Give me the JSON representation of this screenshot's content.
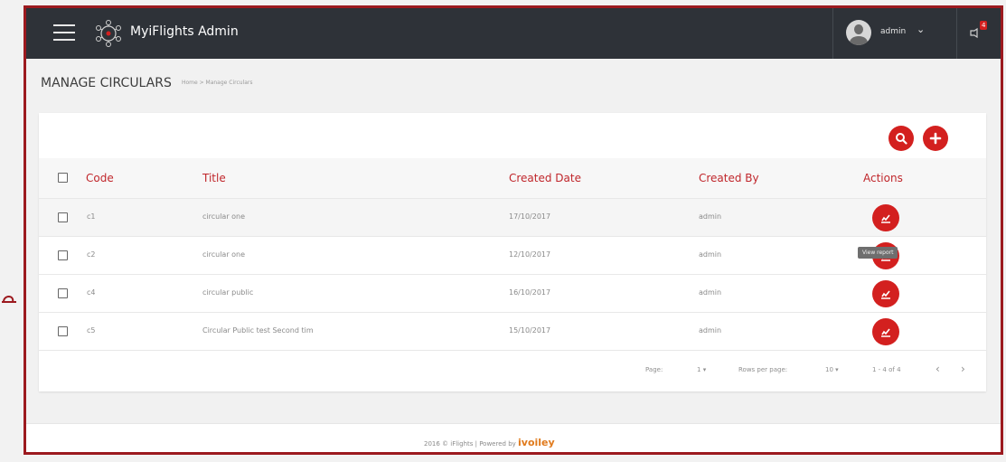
{
  "app": {
    "title": "MyiFlights Admin"
  },
  "user": {
    "name": "admin"
  },
  "notifications": {
    "count": "4"
  },
  "page": {
    "title": "MANAGE CIRCULARS",
    "breadcrumb": "Home  >  Manage Circulars"
  },
  "table": {
    "headers": {
      "code": "Code",
      "title": "Title",
      "created_date": "Created Date",
      "created_by": "Created By",
      "actions": "Actions"
    },
    "rows": [
      {
        "code": "c1",
        "title": "circular one",
        "created_date": "17/10/2017",
        "created_by": "admin"
      },
      {
        "code": "c2",
        "title": "circular one",
        "created_date": "12/10/2017",
        "created_by": "admin"
      },
      {
        "code": "c4",
        "title": "circular public",
        "created_date": "16/10/2017",
        "created_by": "admin"
      },
      {
        "code": "c5",
        "title": "Circular Public test Second tim",
        "created_date": "15/10/2017",
        "created_by": "admin"
      }
    ],
    "tooltip": "View report"
  },
  "pagination": {
    "page_label": "Page:",
    "page_value": "1",
    "rows_label": "Rows per page:",
    "rows_value": "10",
    "range": "1 - 4 of 4",
    "prev_icon": "chevron-left-icon",
    "next_icon": "chevron-right-icon"
  },
  "footer": {
    "text": "2016 © iFlights | Powered by",
    "brand": "ivoiley"
  },
  "colors": {
    "accent": "#d3201f",
    "topbar": "#2e3238",
    "frame": "#9c1a1f"
  }
}
